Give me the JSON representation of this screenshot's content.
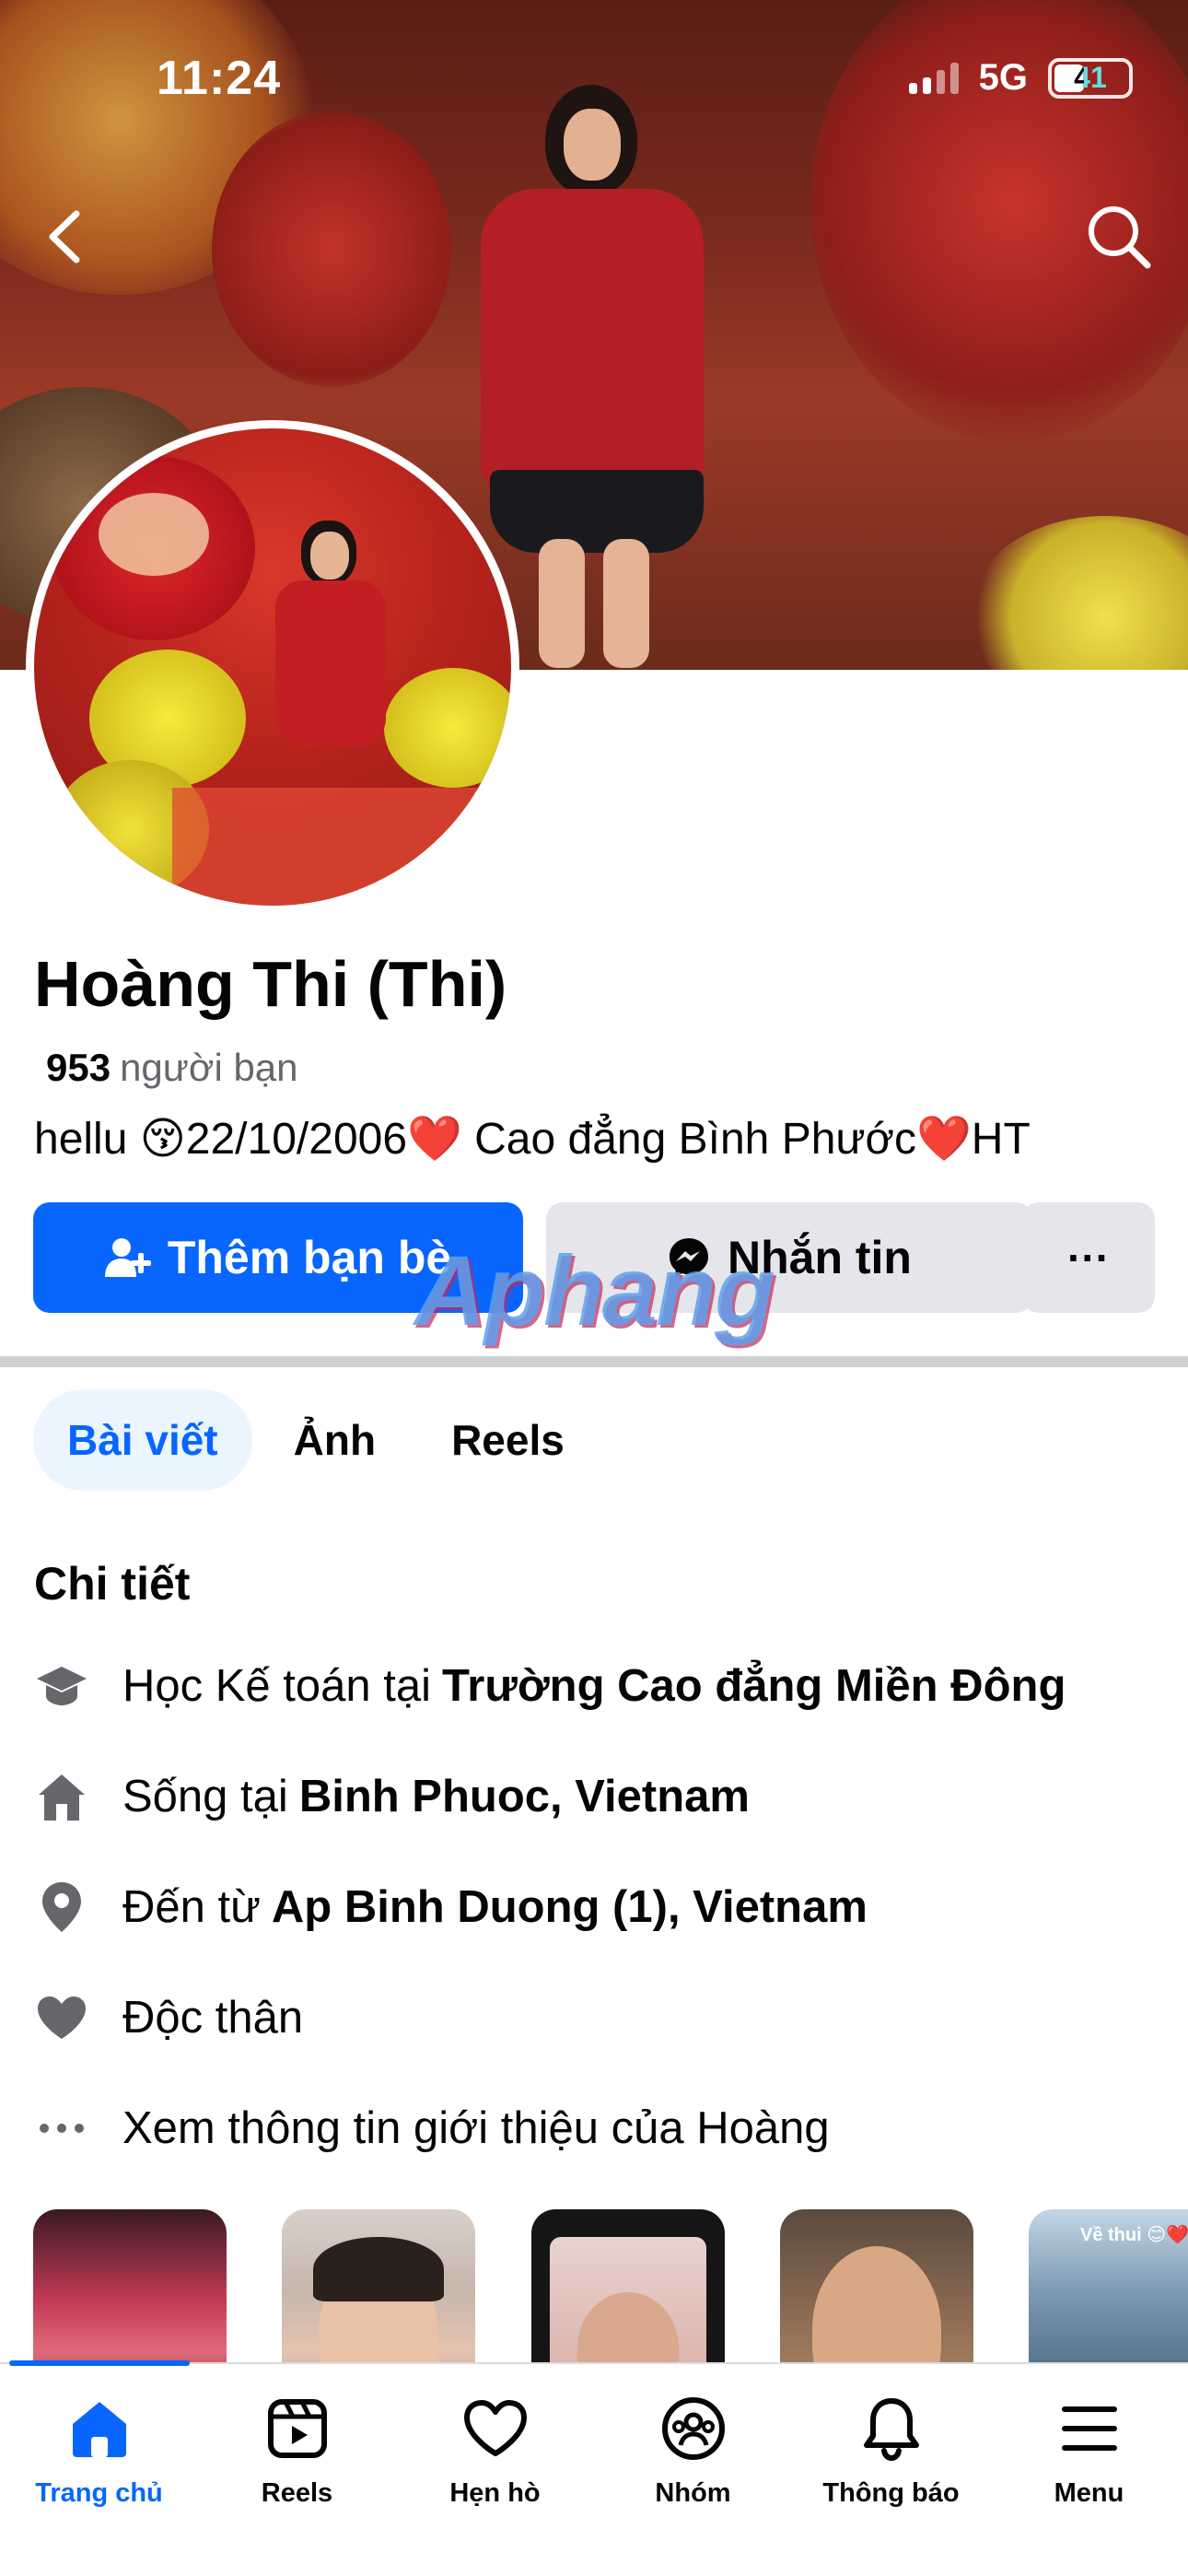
{
  "status_bar": {
    "time": "11:24",
    "network": "5G",
    "battery": "41"
  },
  "profile": {
    "name": "Hoàng Thi (Thi)",
    "friends_count": "953",
    "friends_label": "người bạn",
    "bio": "hellu 😚22/10/2006❤️ Cao đẳng Bình Phước❤️HT"
  },
  "actions": {
    "add_friend": "Thêm bạn bè",
    "message": "Nhắn tin",
    "more": "···"
  },
  "watermark": "Aphang",
  "tabs": [
    {
      "label": "Bài viết",
      "active": true
    },
    {
      "label": "Ảnh",
      "active": false
    },
    {
      "label": "Reels",
      "active": false
    }
  ],
  "details": {
    "title": "Chi tiết",
    "items": [
      {
        "icon": "graduation-cap-icon",
        "prefix": "Học Kế toán tại",
        "value": "Trường Cao đẳng Miền Đông"
      },
      {
        "icon": "home-icon",
        "prefix": "Sống tại",
        "value": "Binh Phuoc, Vietnam"
      },
      {
        "icon": "location-pin-icon",
        "prefix": "Đến từ",
        "value": "Ap Binh Duong (1), Vietnam"
      },
      {
        "icon": "heart-icon",
        "prefix": "Độc thân",
        "value": ""
      },
      {
        "icon": "more-dots-icon",
        "prefix": "Xem thông tin giới thiệu của Hoàng",
        "value": ""
      }
    ]
  },
  "stories": {
    "last_caption": "Về thui 😊❤️"
  },
  "bottom_nav": [
    {
      "label": "Trang chủ",
      "icon": "home-icon",
      "active": true
    },
    {
      "label": "Reels",
      "icon": "reels-icon",
      "active": false
    },
    {
      "label": "Hẹn hò",
      "icon": "dating-heart-icon",
      "active": false
    },
    {
      "label": "Nhóm",
      "icon": "groups-icon",
      "active": false
    },
    {
      "label": "Thông báo",
      "icon": "bell-icon",
      "active": false
    },
    {
      "label": "Menu",
      "icon": "hamburger-icon",
      "active": false
    }
  ],
  "colors": {
    "accent": "#0866ff",
    "secondary_button": "#e4e6eb",
    "muted_text": "#65676b"
  }
}
